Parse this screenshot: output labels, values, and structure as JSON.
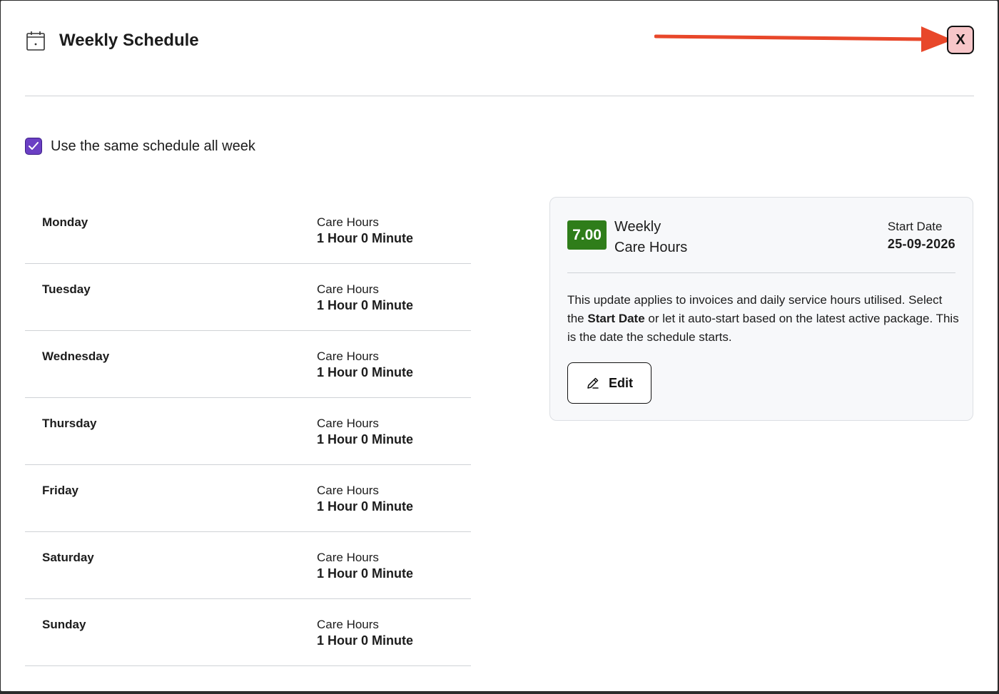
{
  "header": {
    "title": "Weekly Schedule",
    "icon": "calendar-icon",
    "close_label": "X"
  },
  "options": {
    "same_schedule_label": "Use the same schedule all week",
    "same_schedule_checked": true
  },
  "days": [
    {
      "name": "Monday",
      "care_label": "Care Hours",
      "care_value": "1 Hour 0 Minute"
    },
    {
      "name": "Tuesday",
      "care_label": "Care Hours",
      "care_value": "1 Hour 0 Minute"
    },
    {
      "name": "Wednesday",
      "care_label": "Care Hours",
      "care_value": "1 Hour 0 Minute"
    },
    {
      "name": "Thursday",
      "care_label": "Care Hours",
      "care_value": "1 Hour 0 Minute"
    },
    {
      "name": "Friday",
      "care_label": "Care Hours",
      "care_value": "1 Hour 0 Minute"
    },
    {
      "name": "Saturday",
      "care_label": "Care Hours",
      "care_value": "1 Hour 0 Minute"
    },
    {
      "name": "Sunday",
      "care_label": "Care Hours",
      "care_value": "1 Hour 0 Minute"
    }
  ],
  "summary": {
    "weekly_hours": "7.00",
    "weekly_label_line1": "Weekly",
    "weekly_label_line2": "Care Hours",
    "start_date_label": "Start Date",
    "start_date_value": "25-09-2026",
    "desc_part1": "This update applies to invoices and daily service hours utilised. Select the ",
    "desc_bold": "Start Date",
    "desc_part2": " or let it auto-start based on the latest active package. This is the date the schedule starts.",
    "edit_label": "Edit"
  },
  "colors": {
    "accent_checkbox": "#6b3fc4",
    "badge_green": "#2f7d1a",
    "close_bg": "#f7c6c9",
    "arrow_red": "#e8472a"
  }
}
